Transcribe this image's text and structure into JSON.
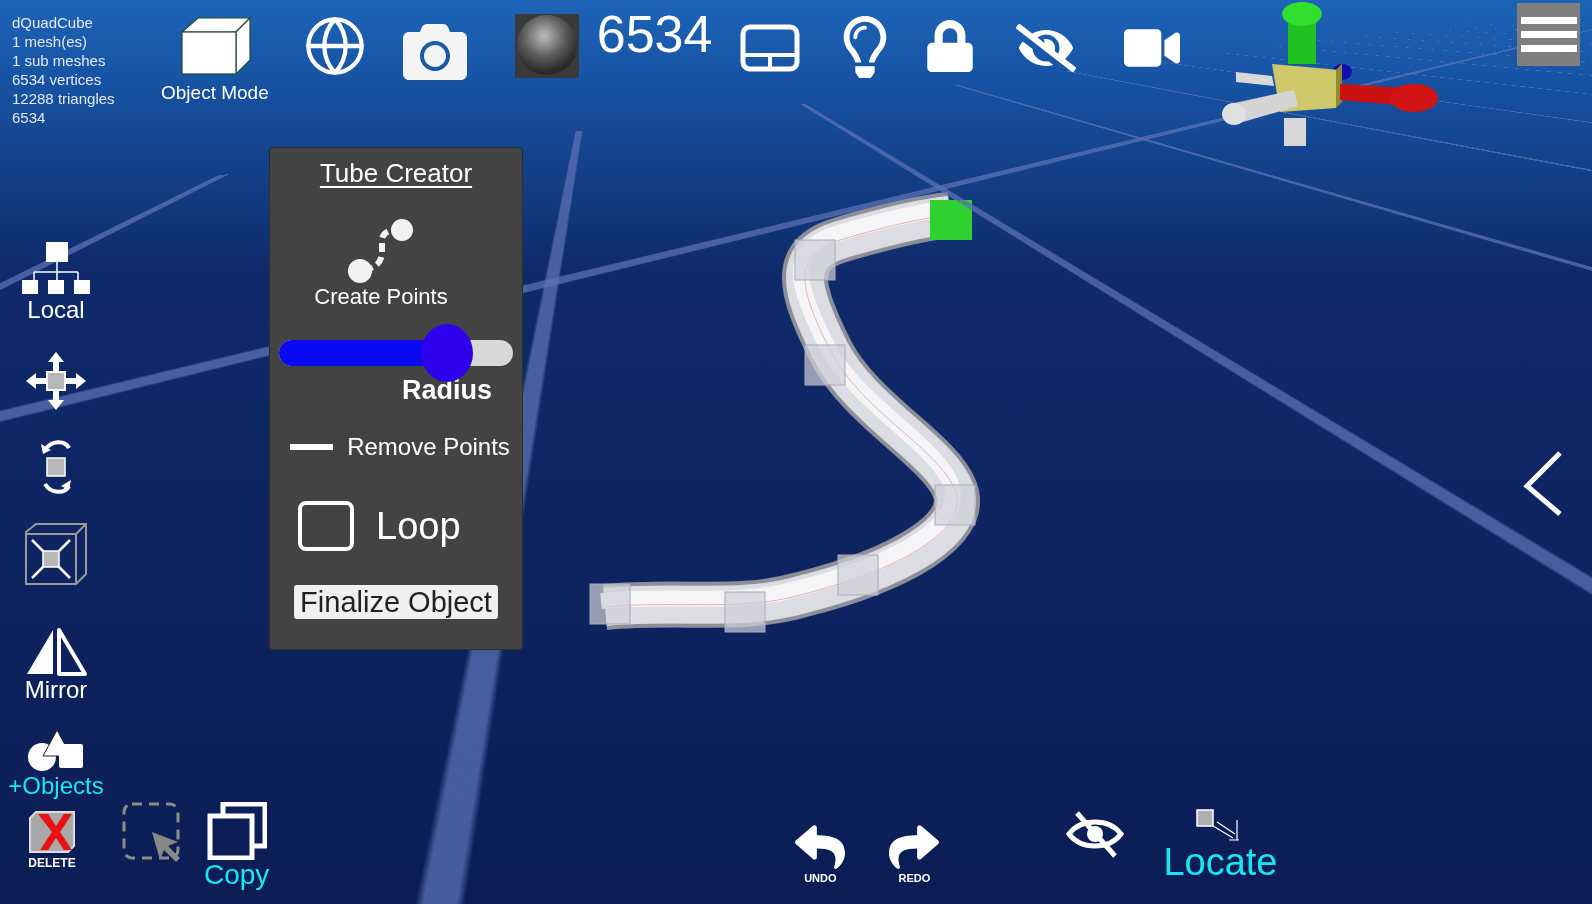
{
  "info": [
    "dQuadCube",
    "1 mesh(es)",
    "1 sub meshes",
    "6534 vertices",
    "12288 triangles",
    "6534"
  ],
  "toolbar": {
    "mode_label": "Object Mode",
    "vertex_count": "6534"
  },
  "left_tools": [
    {
      "kind": "hierarchy",
      "label": "Local"
    },
    {
      "kind": "move"
    },
    {
      "kind": "rotate"
    },
    {
      "kind": "scale"
    },
    {
      "kind": "mirror",
      "label": "Mirror"
    },
    {
      "kind": "objects",
      "label": "+Objects"
    }
  ],
  "bottom_left": {
    "delete_label": "DELETE",
    "copy_label": "Copy"
  },
  "tube_panel": {
    "title": "Tube Creator",
    "create_label": "Create Points",
    "radius": {
      "label": "Radius",
      "level": 0.72
    },
    "remove_label": "Remove Points",
    "loop": {
      "label": "Loop",
      "checked": false
    },
    "finalize_label": "Finalize Object"
  },
  "bottom": {
    "undo_label": "UNDO",
    "redo_label": "REDO",
    "locate_label": "Locate"
  }
}
